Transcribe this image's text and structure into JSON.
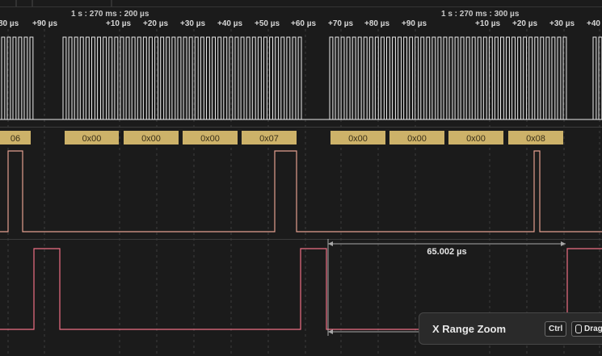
{
  "timeline": {
    "left_marker": "1 s : 270 ms : 200 µs",
    "right_marker": "1 s : 270 ms : 300 µs",
    "ticks": [
      "80 µs",
      "+90 µs",
      "+10 µs",
      "+20 µs",
      "+30 µs",
      "+40 µs",
      "+50 µs",
      "+60 µs",
      "+70 µs",
      "+80 µs",
      "+90 µs",
      "+10 µs",
      "+20 µs",
      "+30 µs",
      "+40"
    ]
  },
  "decoded": {
    "bytes": [
      "06",
      "0x00",
      "0x00",
      "0x00",
      "0x07",
      "0x00",
      "0x00",
      "0x00",
      "0x08"
    ],
    "fill_color": "#cdb269"
  },
  "measurement": {
    "label": "65.002 µs"
  },
  "colors": {
    "clock": "#e8e8e8",
    "ch1": "#e39f8f",
    "ch2": "#ee6f85"
  },
  "zoom_tip": {
    "title": "X Range Zoom",
    "key": "Ctrl",
    "action": "Drag",
    "action_icon": "mouse-icon"
  }
}
